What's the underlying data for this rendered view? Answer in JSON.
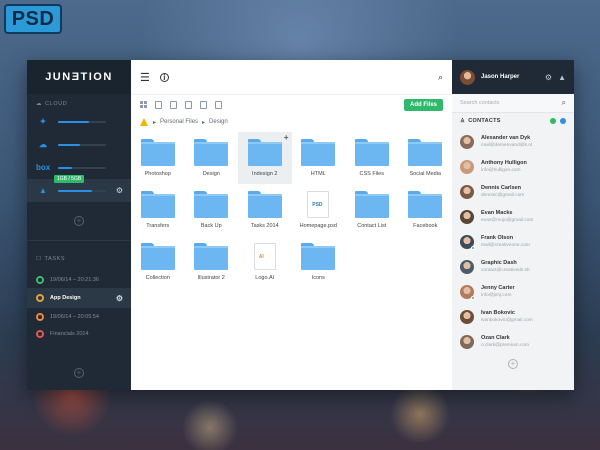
{
  "badge": "PSD",
  "app": {
    "logo": "JUNƎTION",
    "cloud": {
      "title": "CLOUD",
      "items": [
        {
          "name": "dropbox",
          "glyph": "✦",
          "progress": 0.65
        },
        {
          "name": "onedrive",
          "glyph": "☁",
          "progress": 0.45
        },
        {
          "name": "box",
          "glyph": "box",
          "progress": 0.3
        },
        {
          "name": "google-drive",
          "glyph": "▲",
          "progress": 0.7,
          "tooltip": "1GB / 5GB"
        }
      ]
    },
    "tasks": {
      "title": "TASKS",
      "items": [
        {
          "label": "19/06/14 – 20:21:36",
          "color": "#3fb86b"
        },
        {
          "label": "App Design",
          "color": "#e7a13b"
        },
        {
          "label": "19/06/14 – 20:05:54",
          "color": "#e88a3b"
        },
        {
          "label": "Financials 2014",
          "color": "#e25a4a"
        }
      ]
    },
    "main": {
      "add_files": "Add Files",
      "breadcrumb": [
        "Personal Files",
        "Design"
      ],
      "files": [
        {
          "label": "Photoshop",
          "type": "folder"
        },
        {
          "label": "Design",
          "type": "folder"
        },
        {
          "label": "Indesign 2",
          "type": "folder",
          "selected": true
        },
        {
          "label": "HTML",
          "type": "folder"
        },
        {
          "label": "CSS Files",
          "type": "folder"
        },
        {
          "label": "Social Media",
          "type": "folder"
        },
        {
          "label": "Transfers",
          "type": "folder"
        },
        {
          "label": "Back Up",
          "type": "folder"
        },
        {
          "label": "Tasks 2014",
          "type": "folder"
        },
        {
          "label": "Homepage.psd",
          "type": "doc",
          "tag": "PSD",
          "tag_color": "#2c7fb8"
        },
        {
          "label": "Contact List",
          "type": "folder"
        },
        {
          "label": "Facebook",
          "type": "folder"
        },
        {
          "label": "Collection",
          "type": "folder"
        },
        {
          "label": "Illustrator 2",
          "type": "folder"
        },
        {
          "label": "Logo.AI",
          "type": "doc",
          "tag": "AI",
          "tag_color": "#e88a3b"
        },
        {
          "label": "Icons",
          "type": "folder"
        }
      ]
    },
    "right": {
      "user": "Jason Harper",
      "search_placeholder": "Search contacts",
      "contacts_title": "CONTACTS",
      "status_colors": [
        "#2fb96b",
        "#2d8fe3"
      ],
      "contacts": [
        {
          "name": "Alexander van Dyk",
          "email": "mail@demenvand@k.nl",
          "avatar": "#8a6a5a"
        },
        {
          "name": "Anthony Hulligon",
          "email": "info@hulligon.com",
          "avatar": "#c79a7a"
        },
        {
          "name": "Dennis Carlsen",
          "email": "dennisc@gmail.com",
          "avatar": "#7a5a44"
        },
        {
          "name": "Evan Macks",
          "email": "evan@mojo@gmail.com",
          "avatar": "#5a4536"
        },
        {
          "name": "Frank Olson",
          "email": "mail@creativeone.com",
          "avatar": "#3d4a5a",
          "online": true
        },
        {
          "name": "Graphic Dash",
          "email": "contact@creativeds.sh",
          "avatar": "#4e5b68"
        },
        {
          "name": "Jenny Carter",
          "email": "info@jenj.com",
          "avatar": "#b47a5e",
          "online": true
        },
        {
          "name": "Ivan Bokovic",
          "email": "ivanbokovic@gmail.com",
          "avatar": "#6b4d3a"
        },
        {
          "name": "Ozan Clark",
          "email": "o.clark@premium.com",
          "avatar": "#7d6a5b"
        }
      ]
    }
  }
}
